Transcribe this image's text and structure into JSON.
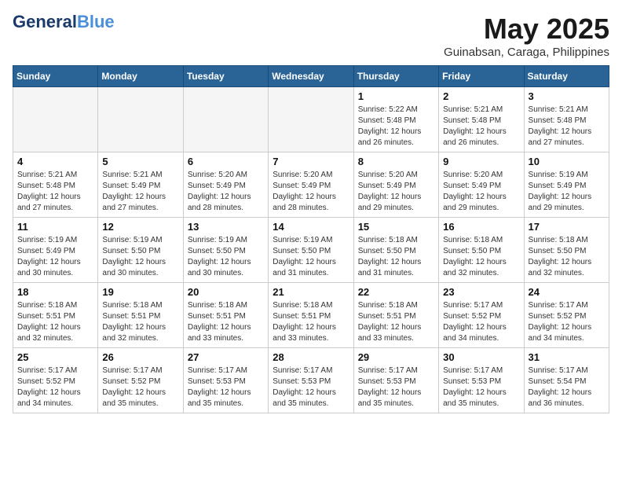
{
  "logo": {
    "general": "General",
    "blue": "Blue",
    "tagline": ""
  },
  "header": {
    "month_year": "May 2025",
    "location": "Guinabsan, Caraga, Philippines"
  },
  "weekdays": [
    "Sunday",
    "Monday",
    "Tuesday",
    "Wednesday",
    "Thursday",
    "Friday",
    "Saturday"
  ],
  "weeks": [
    [
      {
        "day": "",
        "empty": true
      },
      {
        "day": "",
        "empty": true
      },
      {
        "day": "",
        "empty": true
      },
      {
        "day": "",
        "empty": true
      },
      {
        "day": "1",
        "sunrise": "5:22 AM",
        "sunset": "5:48 PM",
        "daylight": "12 hours and 26 minutes."
      },
      {
        "day": "2",
        "sunrise": "5:21 AM",
        "sunset": "5:48 PM",
        "daylight": "12 hours and 26 minutes."
      },
      {
        "day": "3",
        "sunrise": "5:21 AM",
        "sunset": "5:48 PM",
        "daylight": "12 hours and 27 minutes."
      }
    ],
    [
      {
        "day": "4",
        "sunrise": "5:21 AM",
        "sunset": "5:48 PM",
        "daylight": "12 hours and 27 minutes."
      },
      {
        "day": "5",
        "sunrise": "5:21 AM",
        "sunset": "5:49 PM",
        "daylight": "12 hours and 27 minutes."
      },
      {
        "day": "6",
        "sunrise": "5:20 AM",
        "sunset": "5:49 PM",
        "daylight": "12 hours and 28 minutes."
      },
      {
        "day": "7",
        "sunrise": "5:20 AM",
        "sunset": "5:49 PM",
        "daylight": "12 hours and 28 minutes."
      },
      {
        "day": "8",
        "sunrise": "5:20 AM",
        "sunset": "5:49 PM",
        "daylight": "12 hours and 29 minutes."
      },
      {
        "day": "9",
        "sunrise": "5:20 AM",
        "sunset": "5:49 PM",
        "daylight": "12 hours and 29 minutes."
      },
      {
        "day": "10",
        "sunrise": "5:19 AM",
        "sunset": "5:49 PM",
        "daylight": "12 hours and 29 minutes."
      }
    ],
    [
      {
        "day": "11",
        "sunrise": "5:19 AM",
        "sunset": "5:49 PM",
        "daylight": "12 hours and 30 minutes."
      },
      {
        "day": "12",
        "sunrise": "5:19 AM",
        "sunset": "5:50 PM",
        "daylight": "12 hours and 30 minutes."
      },
      {
        "day": "13",
        "sunrise": "5:19 AM",
        "sunset": "5:50 PM",
        "daylight": "12 hours and 30 minutes."
      },
      {
        "day": "14",
        "sunrise": "5:19 AM",
        "sunset": "5:50 PM",
        "daylight": "12 hours and 31 minutes."
      },
      {
        "day": "15",
        "sunrise": "5:18 AM",
        "sunset": "5:50 PM",
        "daylight": "12 hours and 31 minutes."
      },
      {
        "day": "16",
        "sunrise": "5:18 AM",
        "sunset": "5:50 PM",
        "daylight": "12 hours and 32 minutes."
      },
      {
        "day": "17",
        "sunrise": "5:18 AM",
        "sunset": "5:50 PM",
        "daylight": "12 hours and 32 minutes."
      }
    ],
    [
      {
        "day": "18",
        "sunrise": "5:18 AM",
        "sunset": "5:51 PM",
        "daylight": "12 hours and 32 minutes."
      },
      {
        "day": "19",
        "sunrise": "5:18 AM",
        "sunset": "5:51 PM",
        "daylight": "12 hours and 32 minutes."
      },
      {
        "day": "20",
        "sunrise": "5:18 AM",
        "sunset": "5:51 PM",
        "daylight": "12 hours and 33 minutes."
      },
      {
        "day": "21",
        "sunrise": "5:18 AM",
        "sunset": "5:51 PM",
        "daylight": "12 hours and 33 minutes."
      },
      {
        "day": "22",
        "sunrise": "5:18 AM",
        "sunset": "5:51 PM",
        "daylight": "12 hours and 33 minutes."
      },
      {
        "day": "23",
        "sunrise": "5:17 AM",
        "sunset": "5:52 PM",
        "daylight": "12 hours and 34 minutes."
      },
      {
        "day": "24",
        "sunrise": "5:17 AM",
        "sunset": "5:52 PM",
        "daylight": "12 hours and 34 minutes."
      }
    ],
    [
      {
        "day": "25",
        "sunrise": "5:17 AM",
        "sunset": "5:52 PM",
        "daylight": "12 hours and 34 minutes."
      },
      {
        "day": "26",
        "sunrise": "5:17 AM",
        "sunset": "5:52 PM",
        "daylight": "12 hours and 35 minutes."
      },
      {
        "day": "27",
        "sunrise": "5:17 AM",
        "sunset": "5:53 PM",
        "daylight": "12 hours and 35 minutes."
      },
      {
        "day": "28",
        "sunrise": "5:17 AM",
        "sunset": "5:53 PM",
        "daylight": "12 hours and 35 minutes."
      },
      {
        "day": "29",
        "sunrise": "5:17 AM",
        "sunset": "5:53 PM",
        "daylight": "12 hours and 35 minutes."
      },
      {
        "day": "30",
        "sunrise": "5:17 AM",
        "sunset": "5:53 PM",
        "daylight": "12 hours and 35 minutes."
      },
      {
        "day": "31",
        "sunrise": "5:17 AM",
        "sunset": "5:54 PM",
        "daylight": "12 hours and 36 minutes."
      }
    ]
  ]
}
